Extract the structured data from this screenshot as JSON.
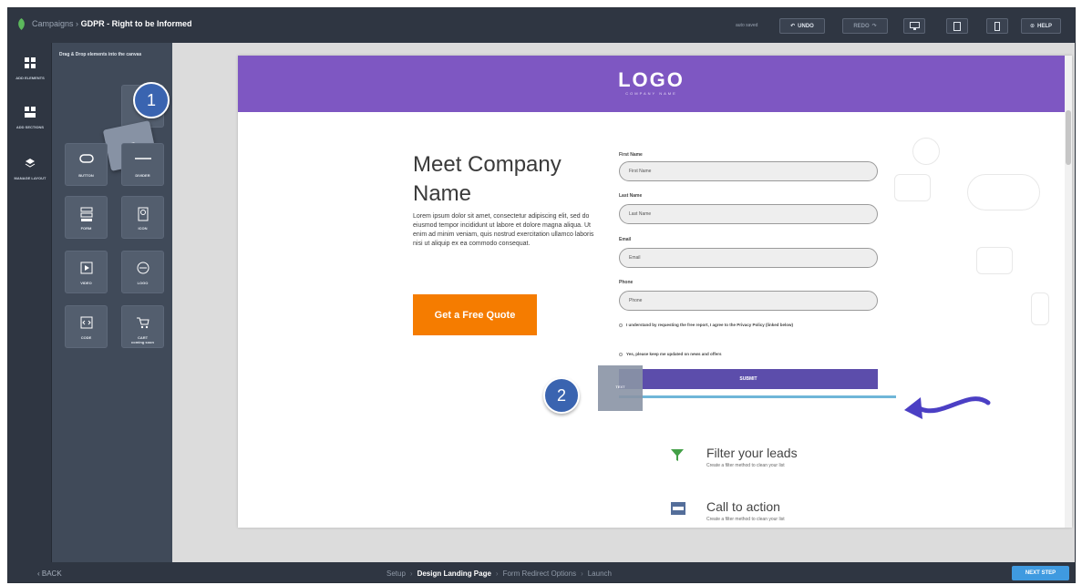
{
  "topbar": {
    "breadcrumb_parent": "Campaigns",
    "breadcrumb_sep": "›",
    "breadcrumb_current": "GDPR - Right to be Informed",
    "autosave": "auto saved",
    "undo": "UNDO",
    "redo": "REDO",
    "help": "HELP",
    "devices": [
      "desktop-icon",
      "tablet-icon",
      "mobile-icon"
    ]
  },
  "rail": {
    "items": [
      {
        "label": "ADD ELEMENTS",
        "icon": "grid-icon"
      },
      {
        "label": "ADD SECTIONS",
        "icon": "sections-icon"
      },
      {
        "label": "MANAGE LAYOUT",
        "icon": "layers-icon"
      }
    ]
  },
  "panel": {
    "header": "Drag & Drop elements into the canvas",
    "dragged_label": "TEXT",
    "elements": [
      {
        "label": "BUTTON",
        "icon": "button-icon"
      },
      {
        "label": "DIVIDER",
        "icon": "divider-icon"
      },
      {
        "label": "FORM",
        "icon": "form-icon"
      },
      {
        "label": "ICON",
        "icon": "badge-icon"
      },
      {
        "label": "VIDEO",
        "icon": "video-icon"
      },
      {
        "label": "LOGO",
        "icon": "logo-icon"
      },
      {
        "label": "CODE",
        "icon": "code-icon"
      },
      {
        "label": "CART",
        "sublabel": "coming soon",
        "icon": "cart-icon"
      }
    ]
  },
  "landing": {
    "logo": "LOGO",
    "logo_sub": "COMPANY NAME",
    "headline": "Meet Company Name",
    "body": "Lorem ipsum dolor sit amet, consectetur adipiscing elit, sed do eiusmod tempor incididunt ut labore et dolore magna aliqua. Ut enim ad minim veniam, quis nostrud exercitation ullamco laboris nisi ut aliquip ex ea commodo consequat.",
    "cta": "Get a Free Quote",
    "form": {
      "fields": [
        {
          "label": "First Name",
          "placeholder": "First Name"
        },
        {
          "label": "Last Name",
          "placeholder": "Last Name"
        },
        {
          "label": "Email",
          "placeholder": "Email"
        },
        {
          "label": "Phone",
          "placeholder": "Phone"
        }
      ],
      "consent_1": "I understand by requesting the free report, I agree to the Privacy Policy (linked below)",
      "consent_2": "Yes, please keep me updated on news and offers",
      "submit": "SUBMIT"
    },
    "ghost_label": "TEXT",
    "features": [
      {
        "title": "Filter your leads",
        "sub": "Create a filter method to clean your list",
        "icon": "funnel-icon"
      },
      {
        "title": "Call to action",
        "sub": "Create a filter method to clean your list",
        "icon": "cta-icon"
      }
    ]
  },
  "bottombar": {
    "back": "‹ BACK",
    "steps": [
      "Setup",
      "Design Landing Page",
      "Form Redirect Options",
      "Launch"
    ],
    "active_step": "Design Landing Page",
    "next": "NEXT STEP"
  },
  "callouts": [
    "1",
    "2"
  ],
  "colors": {
    "hero": "#7e57c2",
    "cta": "#f57c00",
    "submit": "#5c4dab",
    "next": "#3f9ae0",
    "callout": "#3a64b0",
    "dropline": "#6fb6d8"
  }
}
